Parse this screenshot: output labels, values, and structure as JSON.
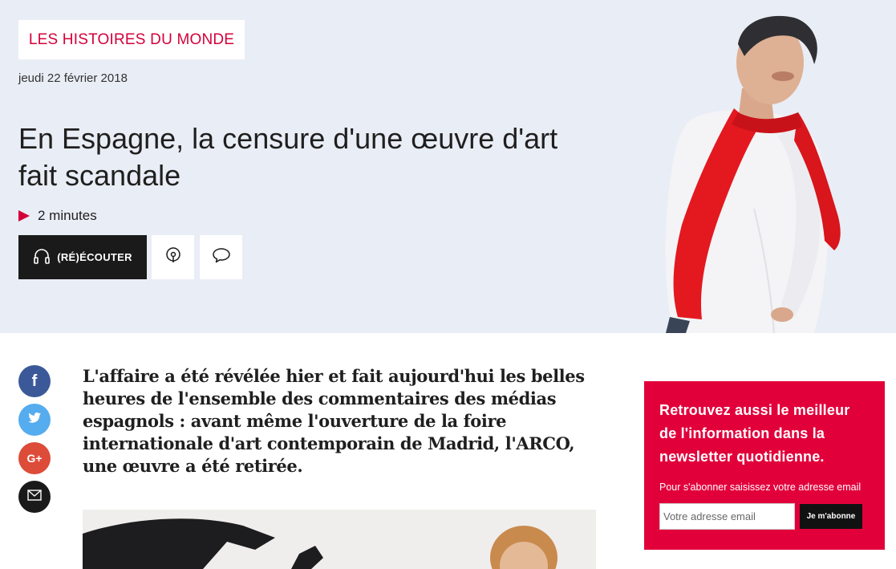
{
  "hero": {
    "show_name": "LES HISTOIRES DU MONDE",
    "date": "jeudi 22 février 2018",
    "headline": "En Espagne, la censure d'une œuvre d'art fait scandale",
    "duration": "2 minutes",
    "listen_label": "(RÉ)ÉCOUTER",
    "accent_color": "#d4003a"
  },
  "icons": {
    "listen": "headphones-icon",
    "podcast": "podcast-icon",
    "comment": "comment-icon",
    "play": "play-icon"
  },
  "share": {
    "facebook": "f",
    "twitter": "twitter-bird-icon",
    "google_plus": "G+",
    "email": "mail-icon"
  },
  "article": {
    "chapo": "L'affaire a été révélée hier et fait aujourd'hui les belles heures de l'ensemble des commentaires des médias espagnols : avant même l'ouverture de la foire internationale d'art contemporain de Madrid, l'ARCO, une œuvre a été retirée."
  },
  "newsletter": {
    "title": "Retrouvez aussi le meilleur de l'information dans la newsletter quotidienne.",
    "hint": "Pour s'abonner saisissez votre adresse email",
    "placeholder": "Votre adresse email",
    "button": "Je m'abonne",
    "background": "#e2003b"
  }
}
